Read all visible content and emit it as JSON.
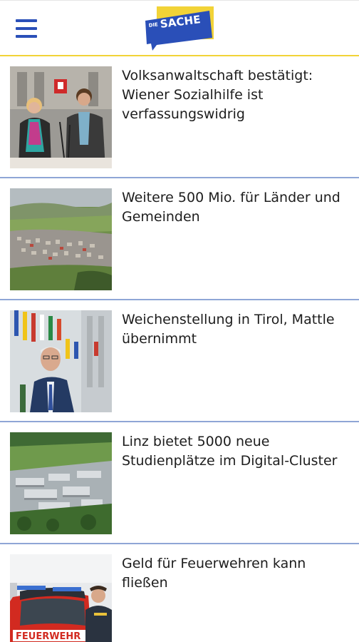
{
  "header": {
    "menu_icon": "hamburger-menu-icon",
    "logo": {
      "prefix": "DIE",
      "name": "SACHE"
    },
    "accent_color": "#f2d337",
    "brand_blue": "#2a4fb8"
  },
  "articles": [
    {
      "headline": "Volksanwaltschaft bestätigt: Wiener Sozialhilfe ist verfassungswidrig",
      "image": "press-conference-photo"
    },
    {
      "headline": "Weitere 500 Mio. für Länder und Gemeinden",
      "image": "aerial-town-photo"
    },
    {
      "headline": "Weichenstellung in Tirol, Mattle übernimmt",
      "image": "politician-with-flags-photo"
    },
    {
      "headline": "Linz bietet 5000 neue Studienplätze im Digital-Cluster",
      "image": "aerial-campus-photo"
    },
    {
      "headline": "Geld für Feuerwehren kann fließen",
      "image": "fire-truck-photo",
      "image_text": "FEUERWEHR"
    }
  ]
}
